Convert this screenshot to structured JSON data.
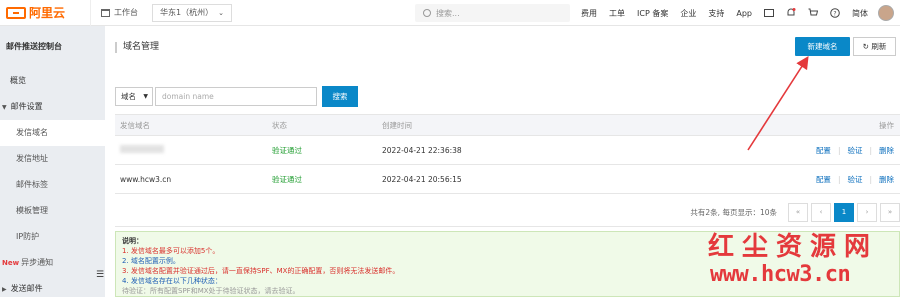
{
  "topbar": {
    "logo_text": "阿里云",
    "workbench": "工作台",
    "region": "华东1（杭州）",
    "search_placeholder": "搜索...",
    "nav": [
      "费用",
      "工单",
      "ICP 备案",
      "企业",
      "支持",
      "App"
    ],
    "lang": "简体"
  },
  "sidebar": {
    "title": "邮件推送控制台",
    "overview": "概览",
    "group_settings": "邮件设置",
    "items": [
      "发信域名",
      "发信地址",
      "邮件标签",
      "模板管理",
      "IP防护"
    ],
    "new_tag": "New",
    "async": "异步通知",
    "send": "发送邮件"
  },
  "main": {
    "title": "域名管理",
    "btn_new": "新建域名",
    "btn_refresh": "刷新",
    "filter_select": "域名",
    "filter_placeholder": "domain name",
    "btn_search": "搜索",
    "columns": [
      "发信域名",
      "状态",
      "创建时间",
      "操作"
    ],
    "rows": [
      {
        "domain": "",
        "status": "验证通过",
        "created": "2022-04-21 22:36:38",
        "actions": [
          "配置",
          "验证",
          "删除"
        ]
      },
      {
        "domain": "www.hcw3.cn",
        "status": "验证通过",
        "created": "2022-04-21 20:56:15",
        "actions": [
          "配置",
          "验证",
          "删除"
        ]
      }
    ],
    "pager_summary": "共有2条, 每页显示：10条",
    "pager_first": "«",
    "pager_prev": "‹",
    "pager_current": "1",
    "pager_next": "›",
    "pager_last": "»",
    "notice": {
      "title": "说明：",
      "line1": "1. 发信域名最多可以添加5个。",
      "line2": "2. 域名配置示例。",
      "line3": "3. 发信域名配置并验证通过后，请一直保持SPF、MX的正确配置，否则将无法发送邮件。",
      "line4": "4. 发信域名存在以下几种状态：",
      "line5": "待验证：所有配置SPF和MX处于待验证状态，请去验证。"
    }
  },
  "watermark": {
    "line1": "红尘资源网",
    "line2": "www.hcw3.cn"
  },
  "colors": {
    "accent": "#0a88c8",
    "brand": "#ff6a00",
    "success": "#1e9c2e",
    "annotation": "#e4393c"
  }
}
